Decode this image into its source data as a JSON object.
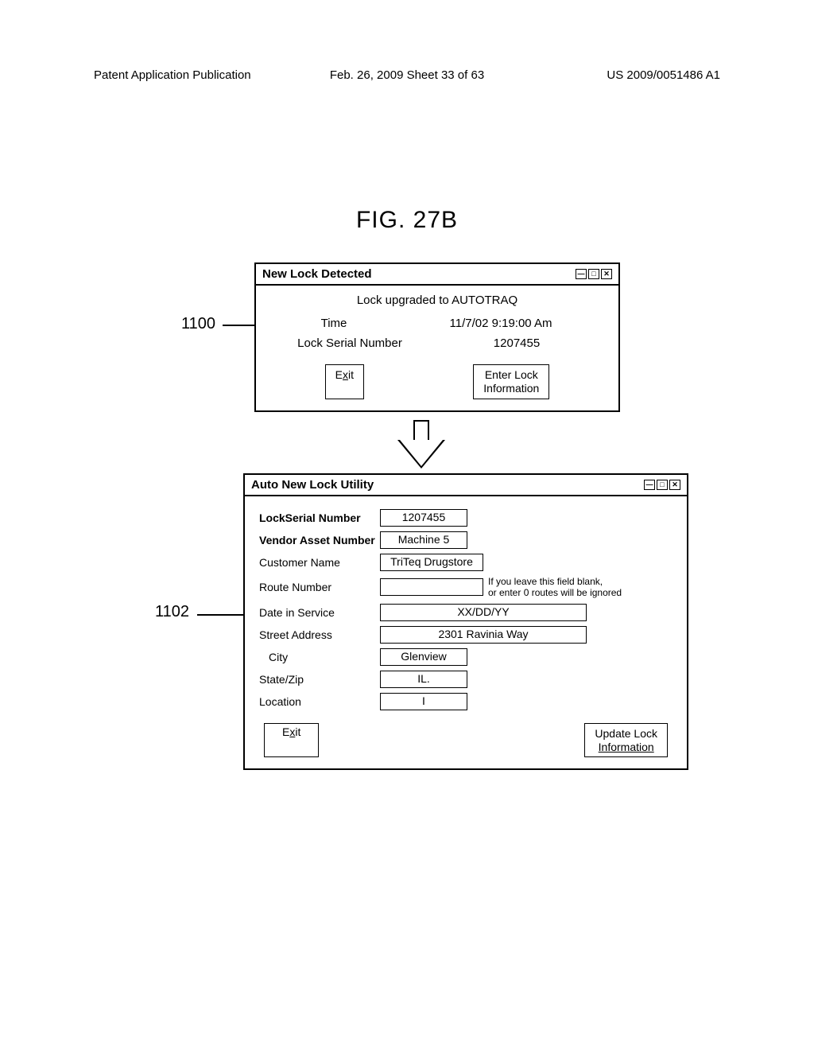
{
  "header": {
    "left": "Patent Application Publication",
    "center": "Feb. 26, 2009  Sheet 33 of 63",
    "right": "US 2009/0051486 A1"
  },
  "figure_title": "FIG. 27B",
  "ref": {
    "r1": "1100",
    "r2": "1102"
  },
  "dlg1": {
    "title": "New Lock Detected",
    "subtitle": "Lock upgraded to AUTOTRAQ",
    "time_label": "Time",
    "time_value": "11/7/02 9:19:00 Am",
    "serial_label": "Lock Serial Number",
    "serial_value": "1207455",
    "exit_prefix": "E",
    "exit_u": "x",
    "exit_suffix": "it",
    "enter_btn_line1": "Enter Lock",
    "enter_btn_line2": "Information"
  },
  "dlg2": {
    "title": "Auto New Lock Utility",
    "serial_label": "LockSerial Number",
    "serial_value": "1207455",
    "vendor_label": "Vendor Asset Number",
    "vendor_value": "Machine 5",
    "customer_label": "Customer Name",
    "customer_value": "TriTeq  Drugstore",
    "route_label": "Route Number",
    "route_value": "",
    "route_note1": "If you leave this field blank,",
    "route_note2": "or enter 0 routes will be ignored",
    "date_label": "Date in Service",
    "date_value": "XX/DD/YY",
    "addr_label": "Street Address",
    "addr_value": "2301 Ravinia Way",
    "city_label": "City",
    "city_value": "Glenview",
    "state_label": "State/Zip",
    "state_value": "IL.",
    "loc_label": "Location",
    "loc_value": "I",
    "exit_prefix": "E",
    "exit_u": "x",
    "exit_suffix": "it",
    "update_btn_line1": "Update Lock",
    "update_btn_line2": "Information"
  }
}
